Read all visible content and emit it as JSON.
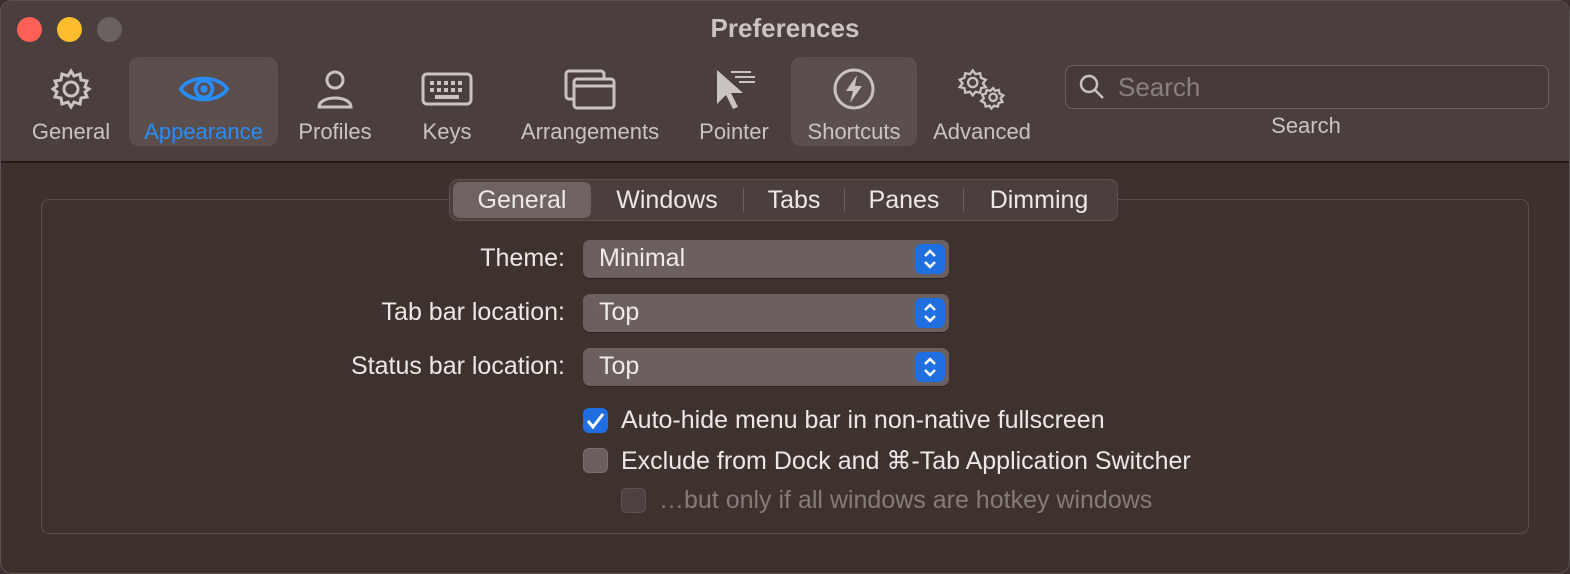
{
  "window": {
    "title": "Preferences"
  },
  "toolbar": {
    "items": [
      {
        "label": "General",
        "icon": "gear-icon"
      },
      {
        "label": "Appearance",
        "icon": "eye-icon"
      },
      {
        "label": "Profiles",
        "icon": "person-icon"
      },
      {
        "label": "Keys",
        "icon": "keyboard-icon"
      },
      {
        "label": "Arrangements",
        "icon": "windows-icon"
      },
      {
        "label": "Pointer",
        "icon": "pointer-icon"
      },
      {
        "label": "Shortcuts",
        "icon": "bolt-icon"
      },
      {
        "label": "Advanced",
        "icon": "gears-icon"
      }
    ],
    "selected": "Appearance",
    "search": {
      "placeholder": "Search",
      "label": "Search"
    }
  },
  "tabs": {
    "items": [
      "General",
      "Windows",
      "Tabs",
      "Panes",
      "Dimming"
    ],
    "selected": "General"
  },
  "form": {
    "theme": {
      "label": "Theme:",
      "value": "Minimal"
    },
    "tab_bar": {
      "label": "Tab bar location:",
      "value": "Top"
    },
    "status_bar": {
      "label": "Status bar location:",
      "value": "Top"
    },
    "checkboxes": [
      {
        "label": "Auto-hide menu bar in non-native fullscreen",
        "checked": true,
        "enabled": true
      },
      {
        "label": "Exclude from Dock and ⌘-Tab Application Switcher",
        "checked": false,
        "enabled": true
      },
      {
        "label": "…but only if all windows are hotkey windows",
        "checked": false,
        "enabled": false
      }
    ]
  },
  "colors": {
    "accent": "#2a8cf7",
    "popup_accent": "#1f6fe0",
    "background": "#3d302d"
  }
}
